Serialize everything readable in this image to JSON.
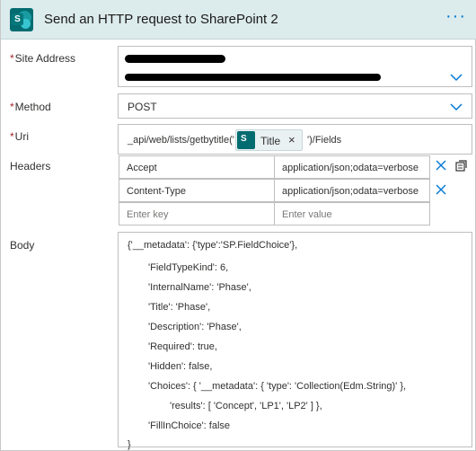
{
  "header": {
    "title": "Send an HTTP request to SharePoint 2",
    "more_label": "···",
    "accent": "#0078d4",
    "background": "#dcebec"
  },
  "site_address": {
    "label": "Site Address",
    "required_mark": "*"
  },
  "method": {
    "label": "Method",
    "required_mark": "*",
    "value": "POST"
  },
  "uri": {
    "label": "Uri",
    "required_mark": "*",
    "prefix": "_api/web/lists/getbytitle('",
    "token_label": "Title",
    "token_remove": "×",
    "suffix": "')/Fields"
  },
  "headers": {
    "label": "Headers",
    "rows": [
      {
        "key": "Accept",
        "value": "application/json;odata=verbose"
      },
      {
        "key": "Content-Type",
        "value": "application/json;odata=verbose"
      }
    ],
    "key_placeholder": "Enter key",
    "value_placeholder": "Enter value"
  },
  "body": {
    "label": "Body",
    "lines": [
      "{'__metadata': {'type':'SP.FieldChoice'},",
      "'FieldTypeKind': 6,",
      "'InternalName': 'Phase',",
      "'Title': 'Phase',",
      "'Description': 'Phase',",
      "'Required': true,",
      "'Hidden': false,",
      "'Choices': { '__metadata': { 'type': 'Collection(Edm.String)' },",
      "'results': [ 'Concept', 'LP1', 'LP2' ] },",
      "'FillInChoice': false",
      "}"
    ]
  },
  "icons": {
    "app": "sharepoint-icon",
    "dropdown": "chevron-down-icon",
    "delete": "close-icon",
    "switch": "switch-mode-icon"
  }
}
